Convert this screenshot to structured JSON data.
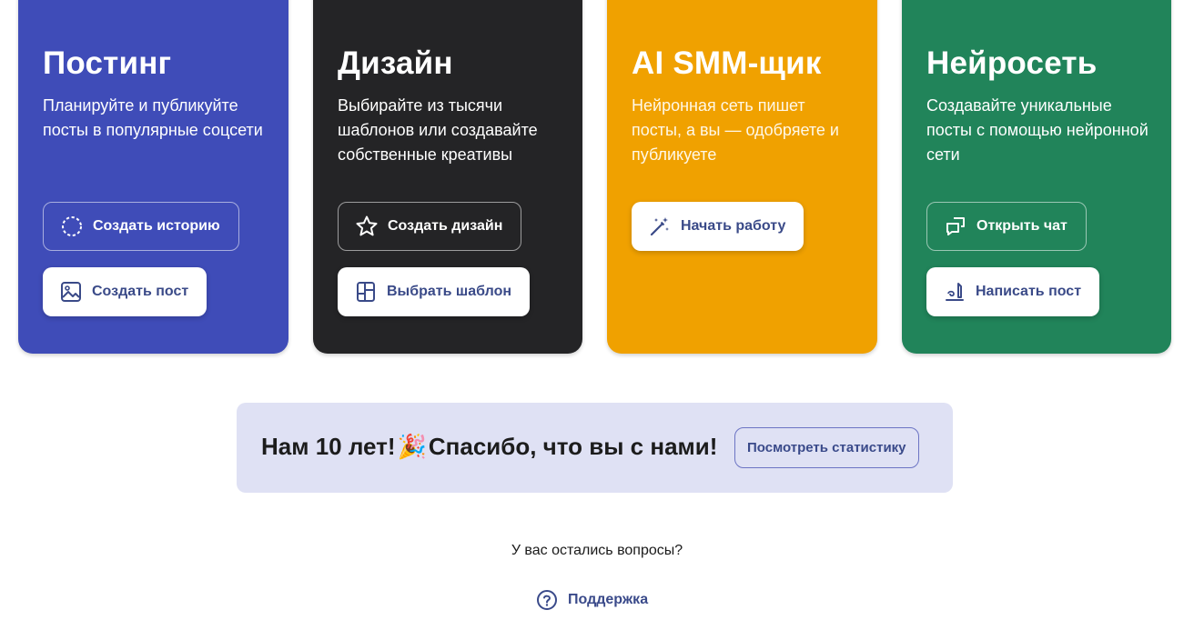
{
  "cards": [
    {
      "title": "Постинг",
      "description": "Планируйте и публикуйте посты в популярные соцсети",
      "color": "#3f4cb8",
      "buttons": [
        {
          "label": "Создать историю",
          "icon": "dashed-circle-icon",
          "style": "outline"
        },
        {
          "label": "Создать пост",
          "icon": "image-icon",
          "style": "solid"
        }
      ]
    },
    {
      "title": "Дизайн",
      "description": "Выбирайте из тысячи шаблонов или создавайте собственные креативы",
      "color": "#242426",
      "buttons": [
        {
          "label": "Создать дизайн",
          "icon": "star-icon",
          "style": "outline"
        },
        {
          "label": "Выбрать шаблон",
          "icon": "template-icon",
          "style": "solid"
        }
      ]
    },
    {
      "title": "AI SMM-щик",
      "description": "Нейронная сеть пишет посты, а вы — одобряете и публикуете",
      "color": "#f0a100",
      "buttons": [
        {
          "label": "Начать работу",
          "icon": "magic-wand-icon",
          "style": "solid"
        }
      ]
    },
    {
      "title": "Нейросеть",
      "description": "Создавайте уникальные посты с помощью нейронной сети",
      "color": "#21845a",
      "buttons": [
        {
          "label": "Открыть чат",
          "icon": "chat-icon",
          "style": "outline"
        },
        {
          "label": "Написать пост",
          "icon": "write-icon",
          "style": "solid"
        }
      ]
    }
  ],
  "banner": {
    "text_before": "Нам 10 лет!",
    "emoji": "🎉",
    "text_after": "Спасибо, что вы с нами!",
    "button_label": "Посмотреть статистику",
    "background": "#dfe1f4"
  },
  "footer": {
    "question": "У вас остались вопросы?",
    "support_label": "Поддержка",
    "support_icon": "question-circle-icon"
  }
}
